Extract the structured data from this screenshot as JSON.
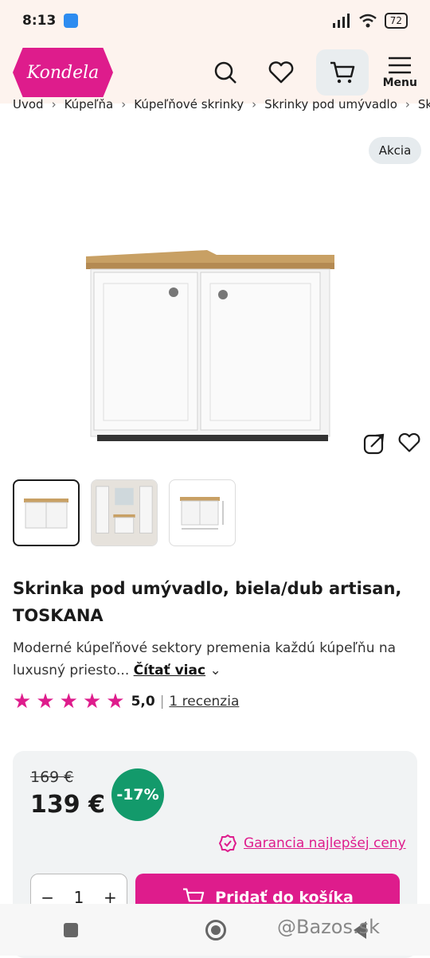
{
  "status_bar": {
    "time": "8:13",
    "battery": "72"
  },
  "header": {
    "logo_text": "Kondela",
    "menu_label": "Menu"
  },
  "breadcrumb": [
    "Úvod",
    "Kúpeľňa",
    "Kúpeľňové skrinky",
    "Skrinky pod umývadlo",
    "Skrinka"
  ],
  "badge": "Akcia",
  "product": {
    "title": "Skrinka pod umývadlo, biela/dub artisan, TOSKANA",
    "description": "Moderné kúpeľňové sektory premenia každú kúpeľňu na luxusný priesto...",
    "read_more": "Čítať viac",
    "rating_score": "5,0",
    "rating_reviews": "1 recenzia",
    "stars": 5
  },
  "price": {
    "old": "169 €",
    "current": "139 €",
    "discount": "-17%",
    "guarantee": "Garancia najlepšej ceny"
  },
  "cart": {
    "quantity": "1",
    "add_label": "Pridať do košíka"
  },
  "watermark": "@Bazos.sk",
  "colors": {
    "brand": "#de1c8c",
    "discount": "#139a6b",
    "header_bg": "#fdf3ee"
  }
}
